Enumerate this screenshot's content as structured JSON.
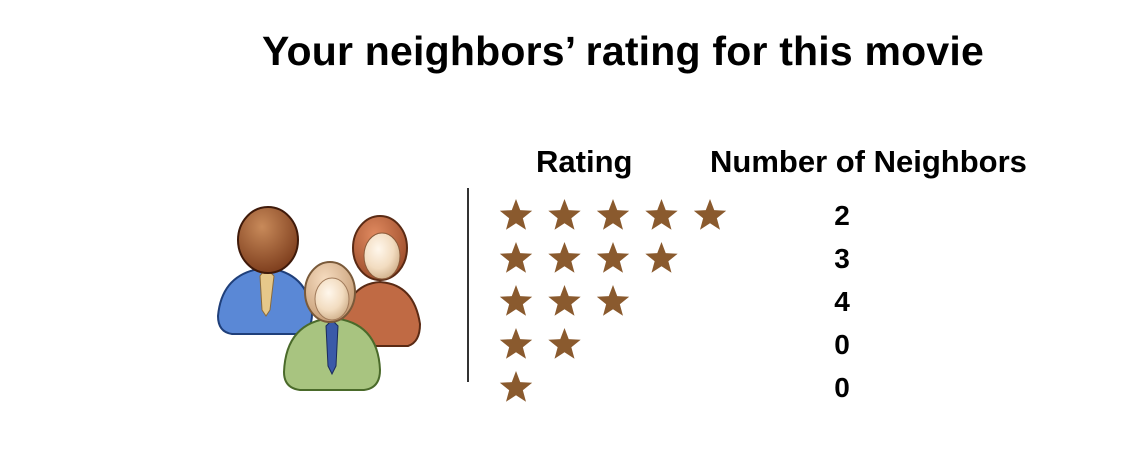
{
  "title": "Your neighbors’ rating for this movie",
  "chart_data": {
    "type": "table",
    "columns": [
      "Rating",
      "Number of Neighbors"
    ],
    "rows": [
      {
        "stars": 5,
        "neighbors": "2"
      },
      {
        "stars": 4,
        "neighbors": "3"
      },
      {
        "stars": 3,
        "neighbors": "4"
      },
      {
        "stars": 2,
        "neighbors": "0"
      },
      {
        "stars": 1,
        "neighbors": "0"
      }
    ]
  },
  "colors": {
    "star": "#8a5a2e",
    "person_blue": "#5a88d6",
    "person_green": "#a8c480",
    "person_rust": "#c06a44"
  },
  "icons": {
    "illustration": "group-of-people-icon",
    "rating_mark": "star-icon"
  }
}
